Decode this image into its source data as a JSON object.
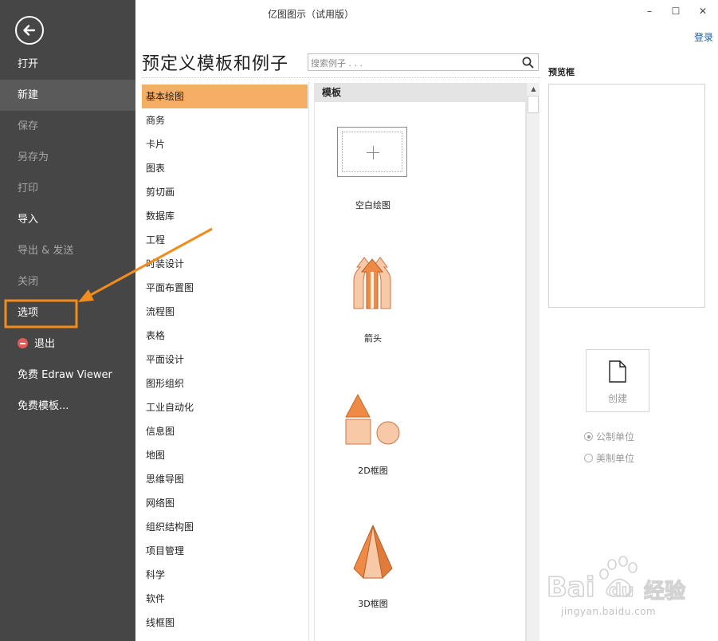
{
  "window": {
    "title": "亿图图示（试用版）",
    "minimize": "–",
    "maximize": "☐",
    "close": "✕",
    "login": "登录"
  },
  "sidebar": {
    "back_icon": "back-arrow-icon",
    "items": [
      {
        "label": "打开",
        "state": "normal"
      },
      {
        "label": "新建",
        "state": "active"
      },
      {
        "label": "保存",
        "state": "disabled"
      },
      {
        "label": "另存为",
        "state": "disabled"
      },
      {
        "label": "打印",
        "state": "disabled"
      },
      {
        "label": "导入",
        "state": "normal"
      },
      {
        "label": "导出 & 发送",
        "state": "disabled"
      },
      {
        "label": "关闭",
        "state": "disabled"
      },
      {
        "label": "选项",
        "state": "normal"
      },
      {
        "label": "退出",
        "state": "normal",
        "icon": "exit-icon"
      },
      {
        "label": "免费 Edraw Viewer",
        "state": "normal"
      },
      {
        "label": "免费模板...",
        "state": "normal"
      }
    ]
  },
  "main": {
    "title": "预定义模板和例子",
    "search_placeholder": "搜索例子 . . .",
    "categories": [
      "基本绘图",
      "商务",
      "卡片",
      "图表",
      "剪切画",
      "数据库",
      "工程",
      "时装设计",
      "平面布置图",
      "流程图",
      "表格",
      "平面设计",
      "图形组织",
      "工业自动化",
      "信息图",
      "地图",
      "思维导图",
      "网络图",
      "组织结构图",
      "项目管理",
      "科学",
      "软件",
      "线框图"
    ],
    "selected_category": "基本绘图"
  },
  "templates": {
    "header": "模板",
    "items": [
      {
        "label": "空白绘图",
        "icon": "blank-drawing-icon"
      },
      {
        "label": "箭头",
        "icon": "arrows-icon"
      },
      {
        "label": "2D框图",
        "icon": "2d-shapes-icon"
      },
      {
        "label": "3D框图",
        "icon": "3d-pyramid-icon"
      }
    ]
  },
  "preview": {
    "title": "预览框",
    "create_label": "创建",
    "units": [
      {
        "label": "公制单位",
        "checked": true
      },
      {
        "label": "美制单位",
        "checked": false
      }
    ]
  },
  "colors": {
    "sidebar_bg": "#464646",
    "selected_category": "#f6ad65",
    "annotation": "#f28c1c",
    "shape_orange": "#ee8a45",
    "shape_light": "#f7c9a7"
  },
  "watermark": {
    "brand": "Bai du 经验",
    "url": "jingyan.baidu.com"
  }
}
